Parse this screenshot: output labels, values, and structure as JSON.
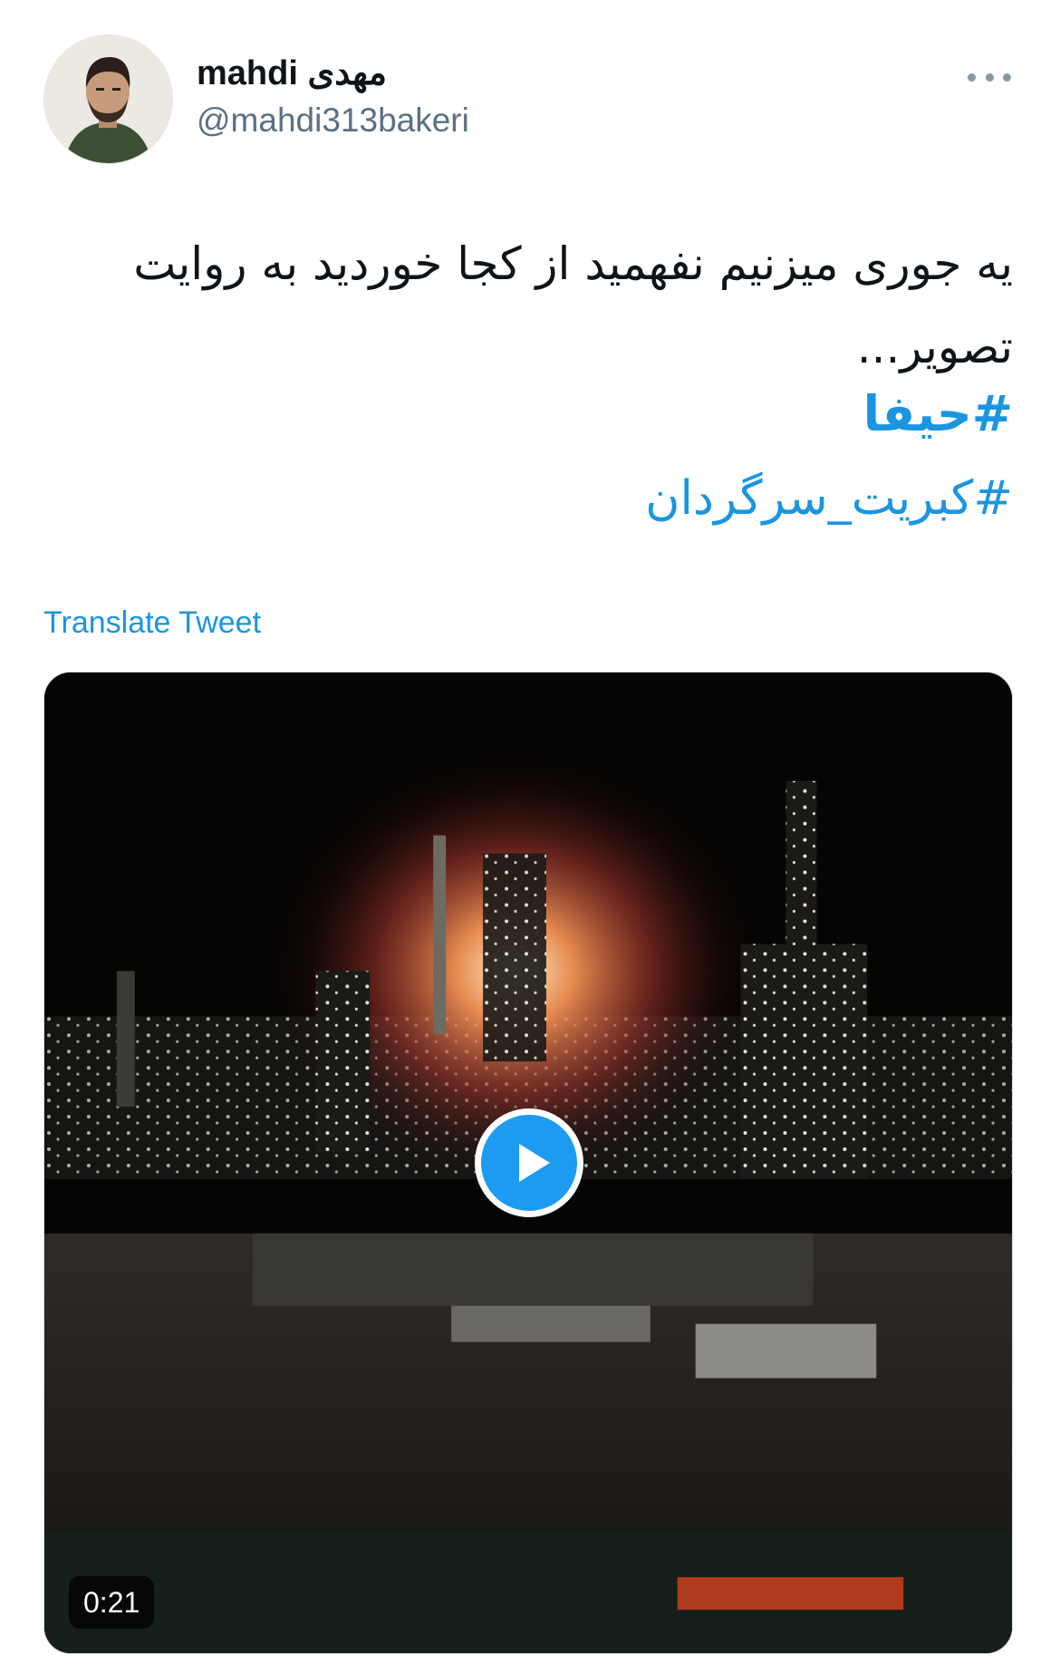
{
  "tweet": {
    "author": {
      "display_name": "mahdi مهدی",
      "handle": "@mahdi313bakeri"
    },
    "text_line_1": "یه جوری میزنیم نفهمید از کجا خوردید به روایت",
    "text_line_2": "تصویر...",
    "hashtags": [
      "#حیفا",
      "#کبریت_سرگردان"
    ],
    "translate_label": "Translate Tweet",
    "media": {
      "duration": "0:21"
    }
  },
  "icons": {
    "more": "more-horizontal-icon",
    "play": "play-icon"
  },
  "colors": {
    "link": "#1b95e0",
    "handle_gray": "#5b7083",
    "play_button": "#1d9bf0"
  }
}
